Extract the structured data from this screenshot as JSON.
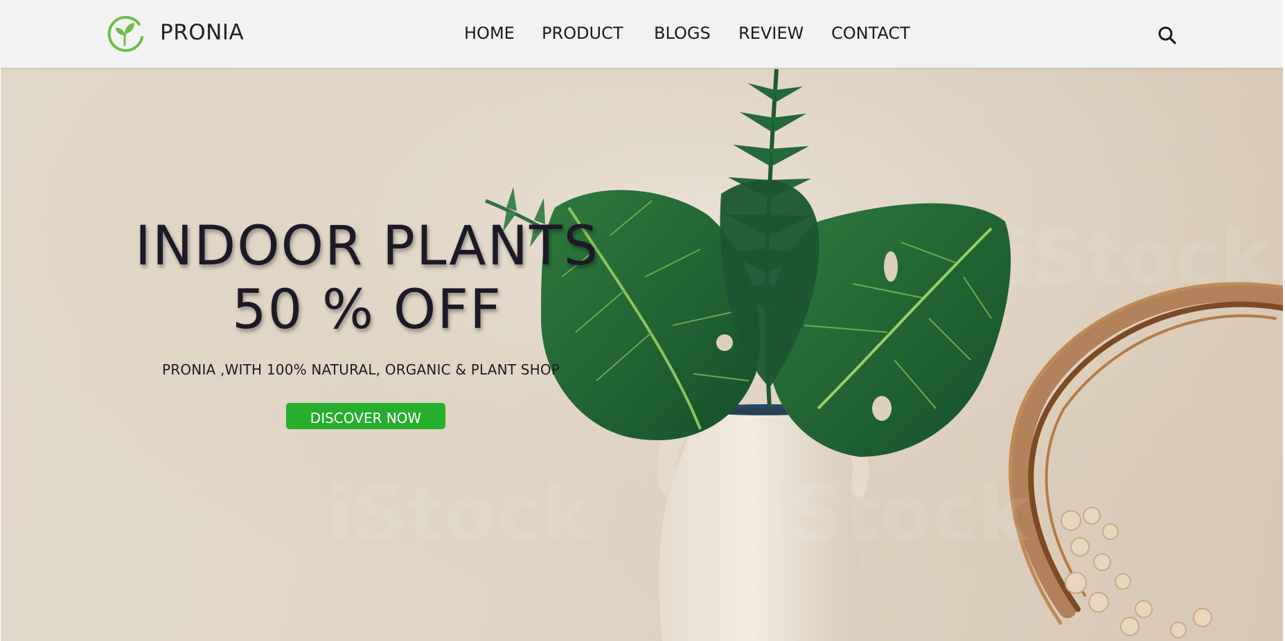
{
  "header": {
    "brand": "PRONIA",
    "logo_icon": "leaf-logo-icon",
    "nav": [
      {
        "label": "HOME"
      },
      {
        "label": "PRODUCT"
      },
      {
        "label": "BLOGS"
      },
      {
        "label": "REVIEW"
      },
      {
        "label": "CONTACT"
      }
    ],
    "search_icon": "search-icon"
  },
  "hero": {
    "title_line1": "INDOOR PLANTS",
    "title_line2": "50 % OFF",
    "subtitle": "PRONIA ,WITH 100% NATURAL, ORGANIC & PLANT SHOP",
    "cta_label": "DISCOVER NOW",
    "image": "potted-monstera-plant-in-white-vase"
  },
  "colors": {
    "accent": "#27ae2d",
    "header_bg": "#f2f2f2",
    "text": "#1c1a26",
    "logo_green": "#6cbd45"
  }
}
